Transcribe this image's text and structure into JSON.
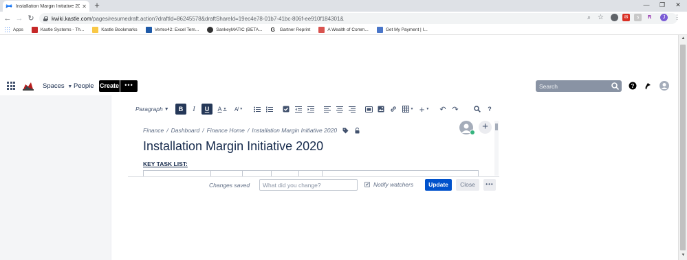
{
  "browser": {
    "tab_title": "Installation Margin Initiative 202…",
    "url_domain": "kwiki.kastle.com",
    "url_rest": "/pages/resumedraft.action?draftId=86245578&draftShareId=19ec4e78-01b7-41bc-806f-ee910f184301&",
    "bookmarks": [
      {
        "label": "Apps",
        "color": "#4285f4"
      },
      {
        "label": "Kastle Systems - Th...",
        "color": "#c62828"
      },
      {
        "label": "Kastle Bookmarks",
        "color": "#f9c846"
      },
      {
        "label": "Vertex42: Excel Tem...",
        "color": "#1e5aa8"
      },
      {
        "label": "SankeyMATIC (BETA...",
        "color": "#333333"
      },
      {
        "label": "Gartner Reprint",
        "color": "#222222"
      },
      {
        "label": "A Wealth of Comm...",
        "color": "#d9534f"
      },
      {
        "label": "Get My Payment | I...",
        "color": "#4a76c9"
      }
    ]
  },
  "header": {
    "spaces": "Spaces",
    "people": "People",
    "create": "Create",
    "more": "•••",
    "search_placeholder": "Search"
  },
  "toolbar": {
    "paragraph": "Paragraph"
  },
  "editor": {
    "breadcrumbs": [
      "Finance",
      "Dashboard",
      "Finance Home",
      "Installation Margin Initiative 2020"
    ],
    "title": "Installation Margin Initiative 2020",
    "key_task": "KEY TASK LIST:"
  },
  "footer": {
    "changes_saved": "Changes saved",
    "change_placeholder": "What did you change?",
    "notify": "Notify watchers",
    "update": "Update",
    "close": "Close",
    "more": "•••"
  },
  "colors": {
    "primary": "#0052cc",
    "header_dark": "#000000",
    "search_bg": "#8993a4"
  }
}
